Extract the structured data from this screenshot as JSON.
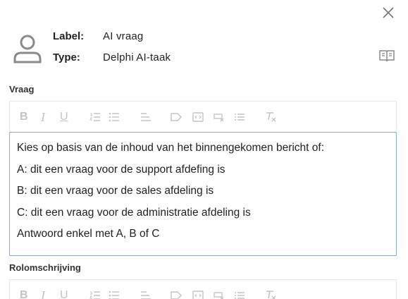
{
  "dialog": {
    "close_icon": "close-icon"
  },
  "header": {
    "label_key": "Label:",
    "label_value": "AI vraag",
    "type_key": "Type:",
    "type_value": "Delphi AI-taak",
    "avatar_icon": "person-icon",
    "docs_icon": "book-icon"
  },
  "vraag": {
    "section_label": "Vraag",
    "toolbar": [
      "bold",
      "italic",
      "underline",
      "ordered-list",
      "bullet-list",
      "align",
      "label",
      "embed",
      "link",
      "list",
      "clear-format"
    ],
    "lines": [
      "Kies op basis van de inhoud van het binnengekomen bericht of:",
      "A: dit een vraag voor de support afdefing is",
      "B: dit een vraag voor de sales afdeling is",
      "C: dit een vraag voor de administratie afdeling is",
      "Antwoord enkel met A, B of C"
    ]
  },
  "rolomschrijving": {
    "section_label": "Rolomschrijving"
  },
  "colors": {
    "icon_gray": "#c4c4c4",
    "editor_border": "#8aaad6"
  }
}
